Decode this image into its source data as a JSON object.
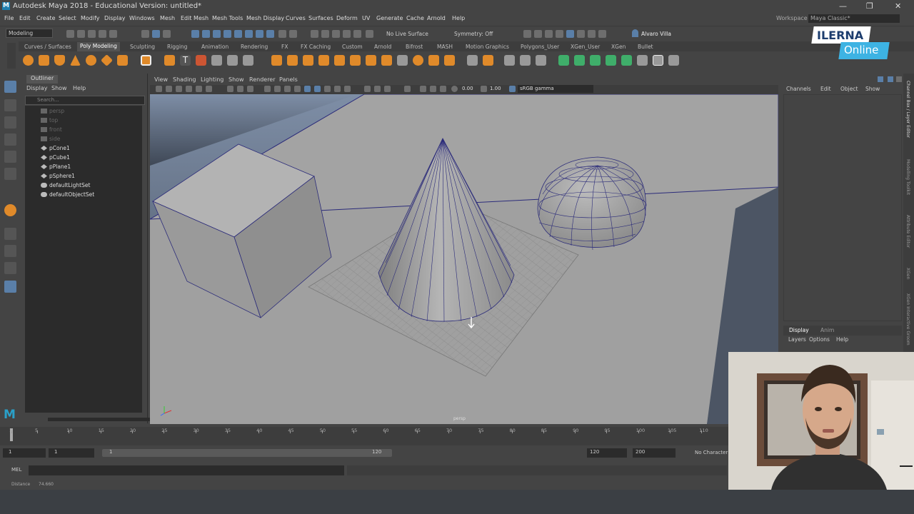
{
  "app": {
    "title": "Autodesk Maya 2018 - Educational Version: untitled*",
    "logo_letter": "M"
  },
  "menu": [
    "File",
    "Edit",
    "Create",
    "Select",
    "Modify",
    "Display",
    "Windows",
    "Mesh",
    "Edit Mesh",
    "Mesh Tools",
    "Mesh Display",
    "Curves",
    "Surfaces",
    "Deform",
    "UV",
    "Generate",
    "Cache",
    "Arnold",
    "Help"
  ],
  "workspace": {
    "label": "Workspace :",
    "value": "Maya Classic*"
  },
  "status": {
    "mode": "Modeling",
    "live_surface": "No Live Surface",
    "symmetry": "Symmetry: Off",
    "user": "Alvaro Villa"
  },
  "shelf_tabs": [
    "Curves / Surfaces",
    "Poly Modeling",
    "Sculpting",
    "Rigging",
    "Animation",
    "Rendering",
    "FX",
    "FX Caching",
    "Custom",
    "Arnold",
    "Bifrost",
    "MASH",
    "Motion Graphics",
    "Polygons_User",
    "XGen_User",
    "XGen",
    "Bullet"
  ],
  "outliner": {
    "title": "Outliner",
    "menu": [
      "Display",
      "Show",
      "Help"
    ],
    "search_placeholder": "Search...",
    "items": [
      {
        "label": "persp",
        "dim": true
      },
      {
        "label": "top",
        "dim": true
      },
      {
        "label": "front",
        "dim": true
      },
      {
        "label": "side",
        "dim": true
      },
      {
        "label": "pCone1",
        "dim": false
      },
      {
        "label": "pCube1",
        "dim": false
      },
      {
        "label": "pPlane1",
        "dim": false
      },
      {
        "label": "pSphere1",
        "dim": false
      },
      {
        "label": "defaultLightSet",
        "dim": false
      },
      {
        "label": "defaultObjectSet",
        "dim": false
      }
    ]
  },
  "viewport": {
    "menu": [
      "View",
      "Shading",
      "Lighting",
      "Show",
      "Renderer",
      "Panels"
    ],
    "exposure": "0.00",
    "gamma": "1.00",
    "color_space": "sRGB gamma",
    "camera_label": "persp"
  },
  "channel_box": {
    "menu": [
      "Channels",
      "Edit",
      "Object",
      "Show"
    ],
    "tabs": [
      "Display",
      "Anim"
    ],
    "layer_menu": [
      "Layers",
      "Options",
      "Help"
    ],
    "side_tabs": [
      "Channel Box / Layer Editor",
      "Modelling Toolkit",
      "Attribute Editor",
      "XGen",
      "XGen Interactive Groom"
    ]
  },
  "timeline": {
    "ticks": [
      "1",
      "5",
      "10",
      "15",
      "20",
      "25",
      "30",
      "35",
      "40",
      "45",
      "50",
      "55",
      "60",
      "65",
      "70",
      "75",
      "80",
      "85",
      "90",
      "95",
      "100",
      "105",
      "110"
    ],
    "start": "1",
    "playback_start": "1",
    "slider_start": "1",
    "slider_end": "120",
    "playback_end": "120",
    "end": "200",
    "character": "No Character"
  },
  "mel": {
    "label": "MEL"
  },
  "help_line": {
    "label": "Distance",
    "value": "74.660"
  },
  "watermark": {
    "line1": "ILERNA",
    "line2": "Online"
  }
}
